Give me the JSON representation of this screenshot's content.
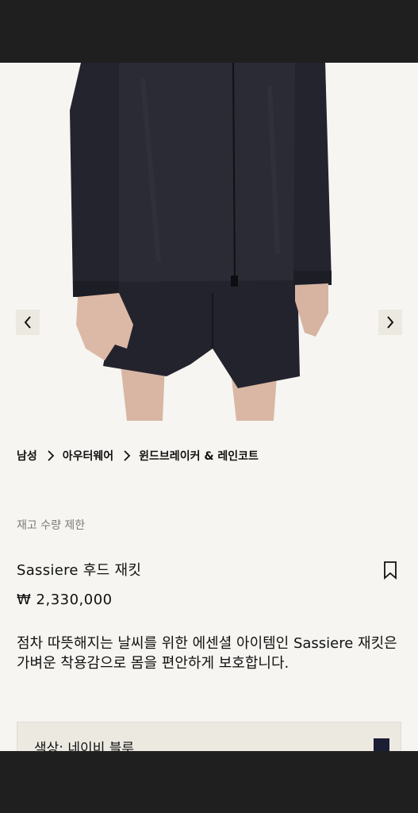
{
  "breadcrumb": {
    "items": [
      "남성",
      "아우터웨어",
      "윈드브레이커 & 레인코트"
    ]
  },
  "product": {
    "stock_note": "재고 수량 제한",
    "title": "Sassiere 후드 재킷",
    "price": "₩ 2,330,000",
    "description": "점차 따뜻해지는 날씨를 위한 에센셜 아이템인 Sassiere 재킷은 가벼운 착용감으로 몸을 편안하게 보호합니다.",
    "color_label": "색상: 네이비 블루",
    "color_swatch": "#1b1e35"
  },
  "icons": {
    "prev": "chevron-left-icon",
    "next": "chevron-right-icon",
    "separator": "chevron-right-icon",
    "bookmark": "bookmark-icon"
  }
}
